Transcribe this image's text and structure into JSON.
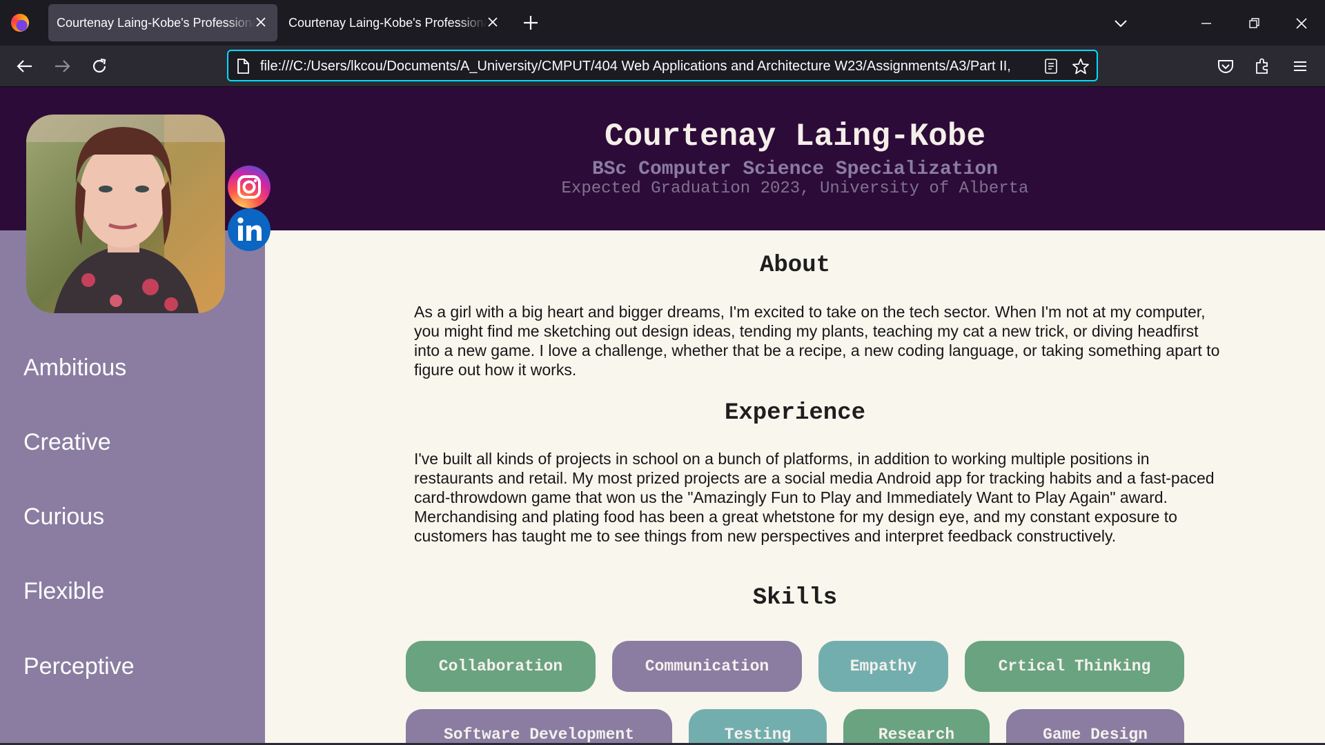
{
  "browser": {
    "tabs": [
      {
        "title": "Courtenay Laing-Kobe's Professional"
      },
      {
        "title": "Courtenay Laing-Kobe's Professional"
      }
    ],
    "url": "file:///C:/Users/lkcou/Documents/A_University/CMPUT/404 Web Applications and Architecture W23/Assignments/A3/Part II,"
  },
  "header": {
    "name": "Courtenay Laing-Kobe",
    "degree": "BSc Computer Science Specialization",
    "graduation": "Expected Graduation 2023, University of Alberta"
  },
  "sidebar": {
    "traits": [
      "Ambitious",
      "Creative",
      "Curious",
      "Flexible",
      "Perceptive"
    ]
  },
  "about": {
    "title": "About",
    "text": "As a girl with a big heart and bigger dreams, I'm excited to take on the tech sector. When I'm not at my computer, you might find me sketching out design ideas, tending my plants, teaching my cat a new trick, or diving headfirst into a new game. I love a challenge, whether that be a recipe, a new coding language, or taking something apart to figure out how it works."
  },
  "experience": {
    "title": "Experience",
    "text": "I've built all kinds of projects in school on a bunch of platforms, in addition to working multiple positions in restaurants and retail. My most prized projects are a social media Android app for tracking habits and a fast-paced card-throwdown game that won us the \"Amazingly Fun to Play and Immediately Want to Play Again\" award. Merchandising and plating food has been a great whetstone for my design eye, and my constant exposure to customers has taught me to see things from new perspectives and interpret feedback constructively."
  },
  "skills": {
    "title": "Skills",
    "items": [
      {
        "label": "Collaboration",
        "color": "#6aa37f"
      },
      {
        "label": "Communication",
        "color": "#8a7da1"
      },
      {
        "label": "Empathy",
        "color": "#73aeae"
      },
      {
        "label": "Crtical Thinking",
        "color": "#6aa37f"
      },
      {
        "label": "Software Development",
        "color": "#8a7da1"
      },
      {
        "label": "Testing",
        "color": "#73aeae"
      },
      {
        "label": "Research",
        "color": "#6aa37f"
      },
      {
        "label": "Game Design",
        "color": "#8a7da1"
      }
    ]
  },
  "colors": {
    "header_bg": "#2d0b38",
    "sidebar_bg": "#8a7da1",
    "page_bg": "#f9f6ee",
    "url_focus": "#00ddff"
  }
}
